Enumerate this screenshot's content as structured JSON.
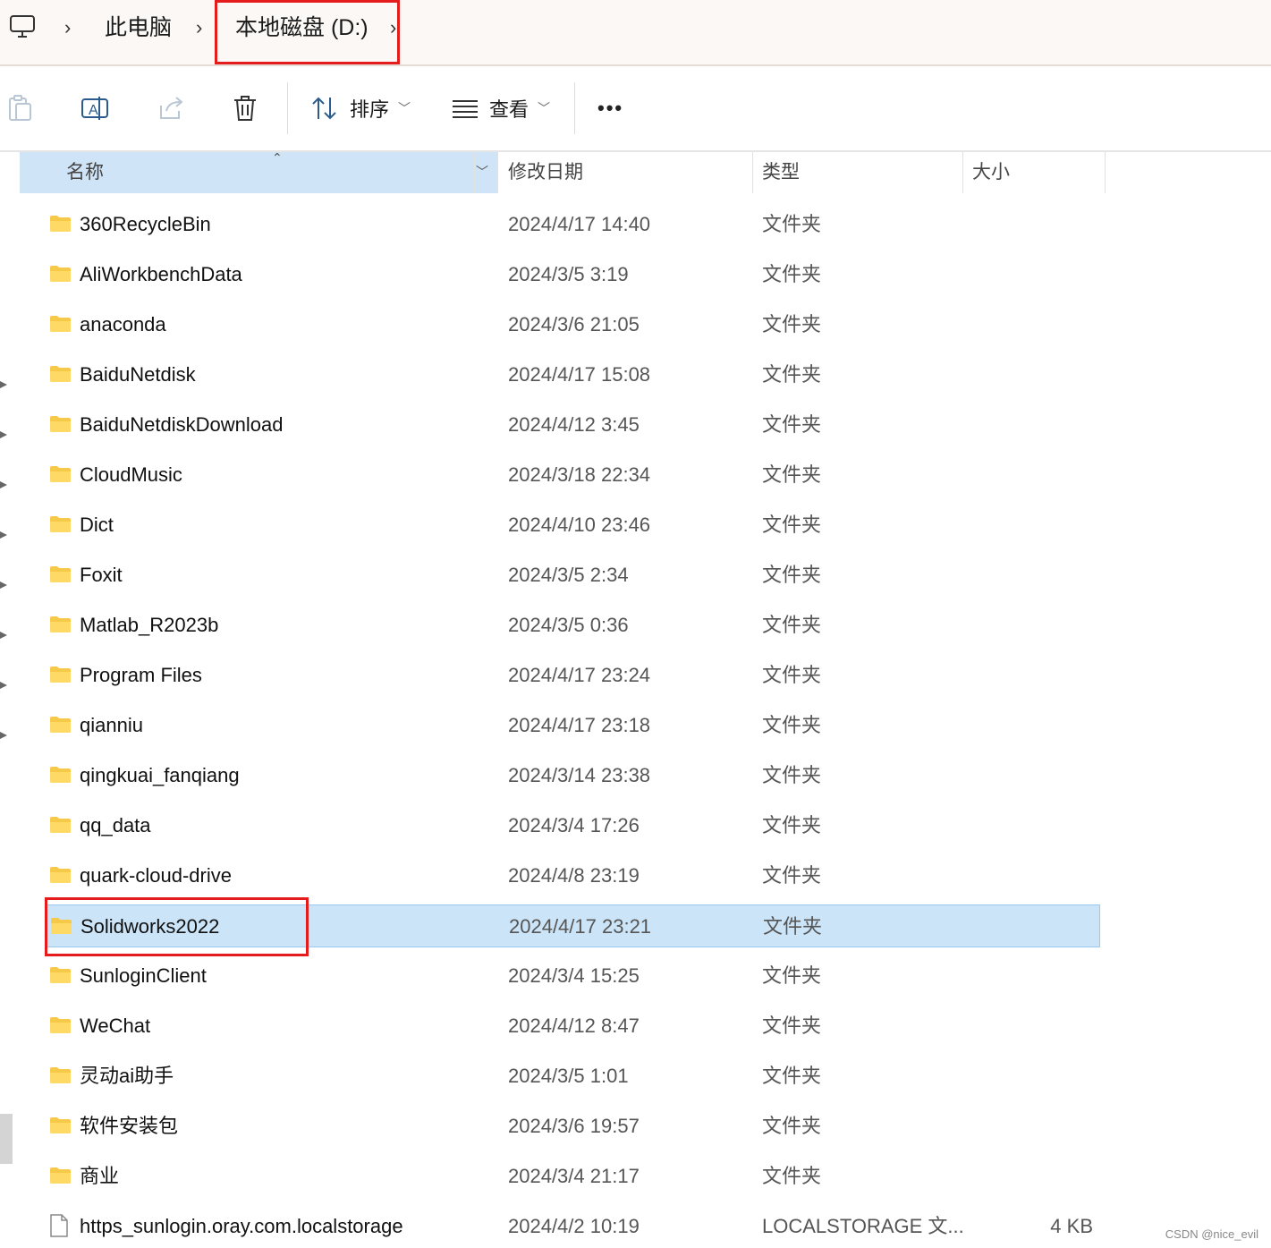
{
  "breadcrumb": {
    "root_icon": "computer-icon",
    "items": [
      "此电脑",
      "本地磁盘 (D:)"
    ]
  },
  "toolbar": {
    "sort_label": "排序",
    "view_label": "查看",
    "more_label": "•••"
  },
  "columns": {
    "name": "名称",
    "modified": "修改日期",
    "type": "类型",
    "size": "大小"
  },
  "files": [
    {
      "name": "360RecycleBin",
      "modified": "2024/4/17 14:40",
      "type": "文件夹",
      "size": "",
      "icon": "folder-icon",
      "selected": false
    },
    {
      "name": "AliWorkbenchData",
      "modified": "2024/3/5 3:19",
      "type": "文件夹",
      "size": "",
      "icon": "folder-icon",
      "selected": false
    },
    {
      "name": "anaconda",
      "modified": "2024/3/6 21:05",
      "type": "文件夹",
      "size": "",
      "icon": "folder-icon",
      "selected": false
    },
    {
      "name": "BaiduNetdisk",
      "modified": "2024/4/17 15:08",
      "type": "文件夹",
      "size": "",
      "icon": "folder-icon",
      "selected": false
    },
    {
      "name": "BaiduNetdiskDownload",
      "modified": "2024/4/12 3:45",
      "type": "文件夹",
      "size": "",
      "icon": "folder-icon",
      "selected": false
    },
    {
      "name": "CloudMusic",
      "modified": "2024/3/18 22:34",
      "type": "文件夹",
      "size": "",
      "icon": "folder-icon",
      "selected": false
    },
    {
      "name": "Dict",
      "modified": "2024/4/10 23:46",
      "type": "文件夹",
      "size": "",
      "icon": "folder-icon",
      "selected": false
    },
    {
      "name": "Foxit",
      "modified": "2024/3/5 2:34",
      "type": "文件夹",
      "size": "",
      "icon": "folder-icon",
      "selected": false
    },
    {
      "name": "Matlab_R2023b",
      "modified": "2024/3/5 0:36",
      "type": "文件夹",
      "size": "",
      "icon": "folder-icon",
      "selected": false
    },
    {
      "name": "Program Files",
      "modified": "2024/4/17 23:24",
      "type": "文件夹",
      "size": "",
      "icon": "folder-icon",
      "selected": false
    },
    {
      "name": "qianniu",
      "modified": "2024/4/17 23:18",
      "type": "文件夹",
      "size": "",
      "icon": "folder-icon",
      "selected": false
    },
    {
      "name": "qingkuai_fanqiang",
      "modified": "2024/3/14 23:38",
      "type": "文件夹",
      "size": "",
      "icon": "folder-icon",
      "selected": false
    },
    {
      "name": "qq_data",
      "modified": "2024/3/4 17:26",
      "type": "文件夹",
      "size": "",
      "icon": "folder-icon",
      "selected": false
    },
    {
      "name": "quark-cloud-drive",
      "modified": "2024/4/8 23:19",
      "type": "文件夹",
      "size": "",
      "icon": "folder-icon",
      "selected": false
    },
    {
      "name": "Solidworks2022",
      "modified": "2024/4/17 23:21",
      "type": "文件夹",
      "size": "",
      "icon": "folder-icon",
      "selected": true
    },
    {
      "name": "SunloginClient",
      "modified": "2024/3/4 15:25",
      "type": "文件夹",
      "size": "",
      "icon": "folder-icon",
      "selected": false
    },
    {
      "name": "WeChat",
      "modified": "2024/4/12 8:47",
      "type": "文件夹",
      "size": "",
      "icon": "folder-icon",
      "selected": false
    },
    {
      "name": "灵动ai助手",
      "modified": "2024/3/5 1:01",
      "type": "文件夹",
      "size": "",
      "icon": "folder-icon",
      "selected": false
    },
    {
      "name": "软件安装包",
      "modified": "2024/3/6 19:57",
      "type": "文件夹",
      "size": "",
      "icon": "folder-icon",
      "selected": false
    },
    {
      "name": "商业",
      "modified": "2024/3/4 21:17",
      "type": "文件夹",
      "size": "",
      "icon": "folder-icon",
      "selected": false
    },
    {
      "name": "https_sunlogin.oray.com.localstorage",
      "modified": "2024/4/2 10:19",
      "type": "LOCALSTORAGE 文...",
      "size": "4 KB",
      "icon": "file-icon",
      "selected": false
    }
  ],
  "watermark": "CSDN @nice_evil",
  "colors": {
    "highlight_box": "#e51c1c",
    "selection": "#cce4f7",
    "folder": "#f7c948"
  }
}
